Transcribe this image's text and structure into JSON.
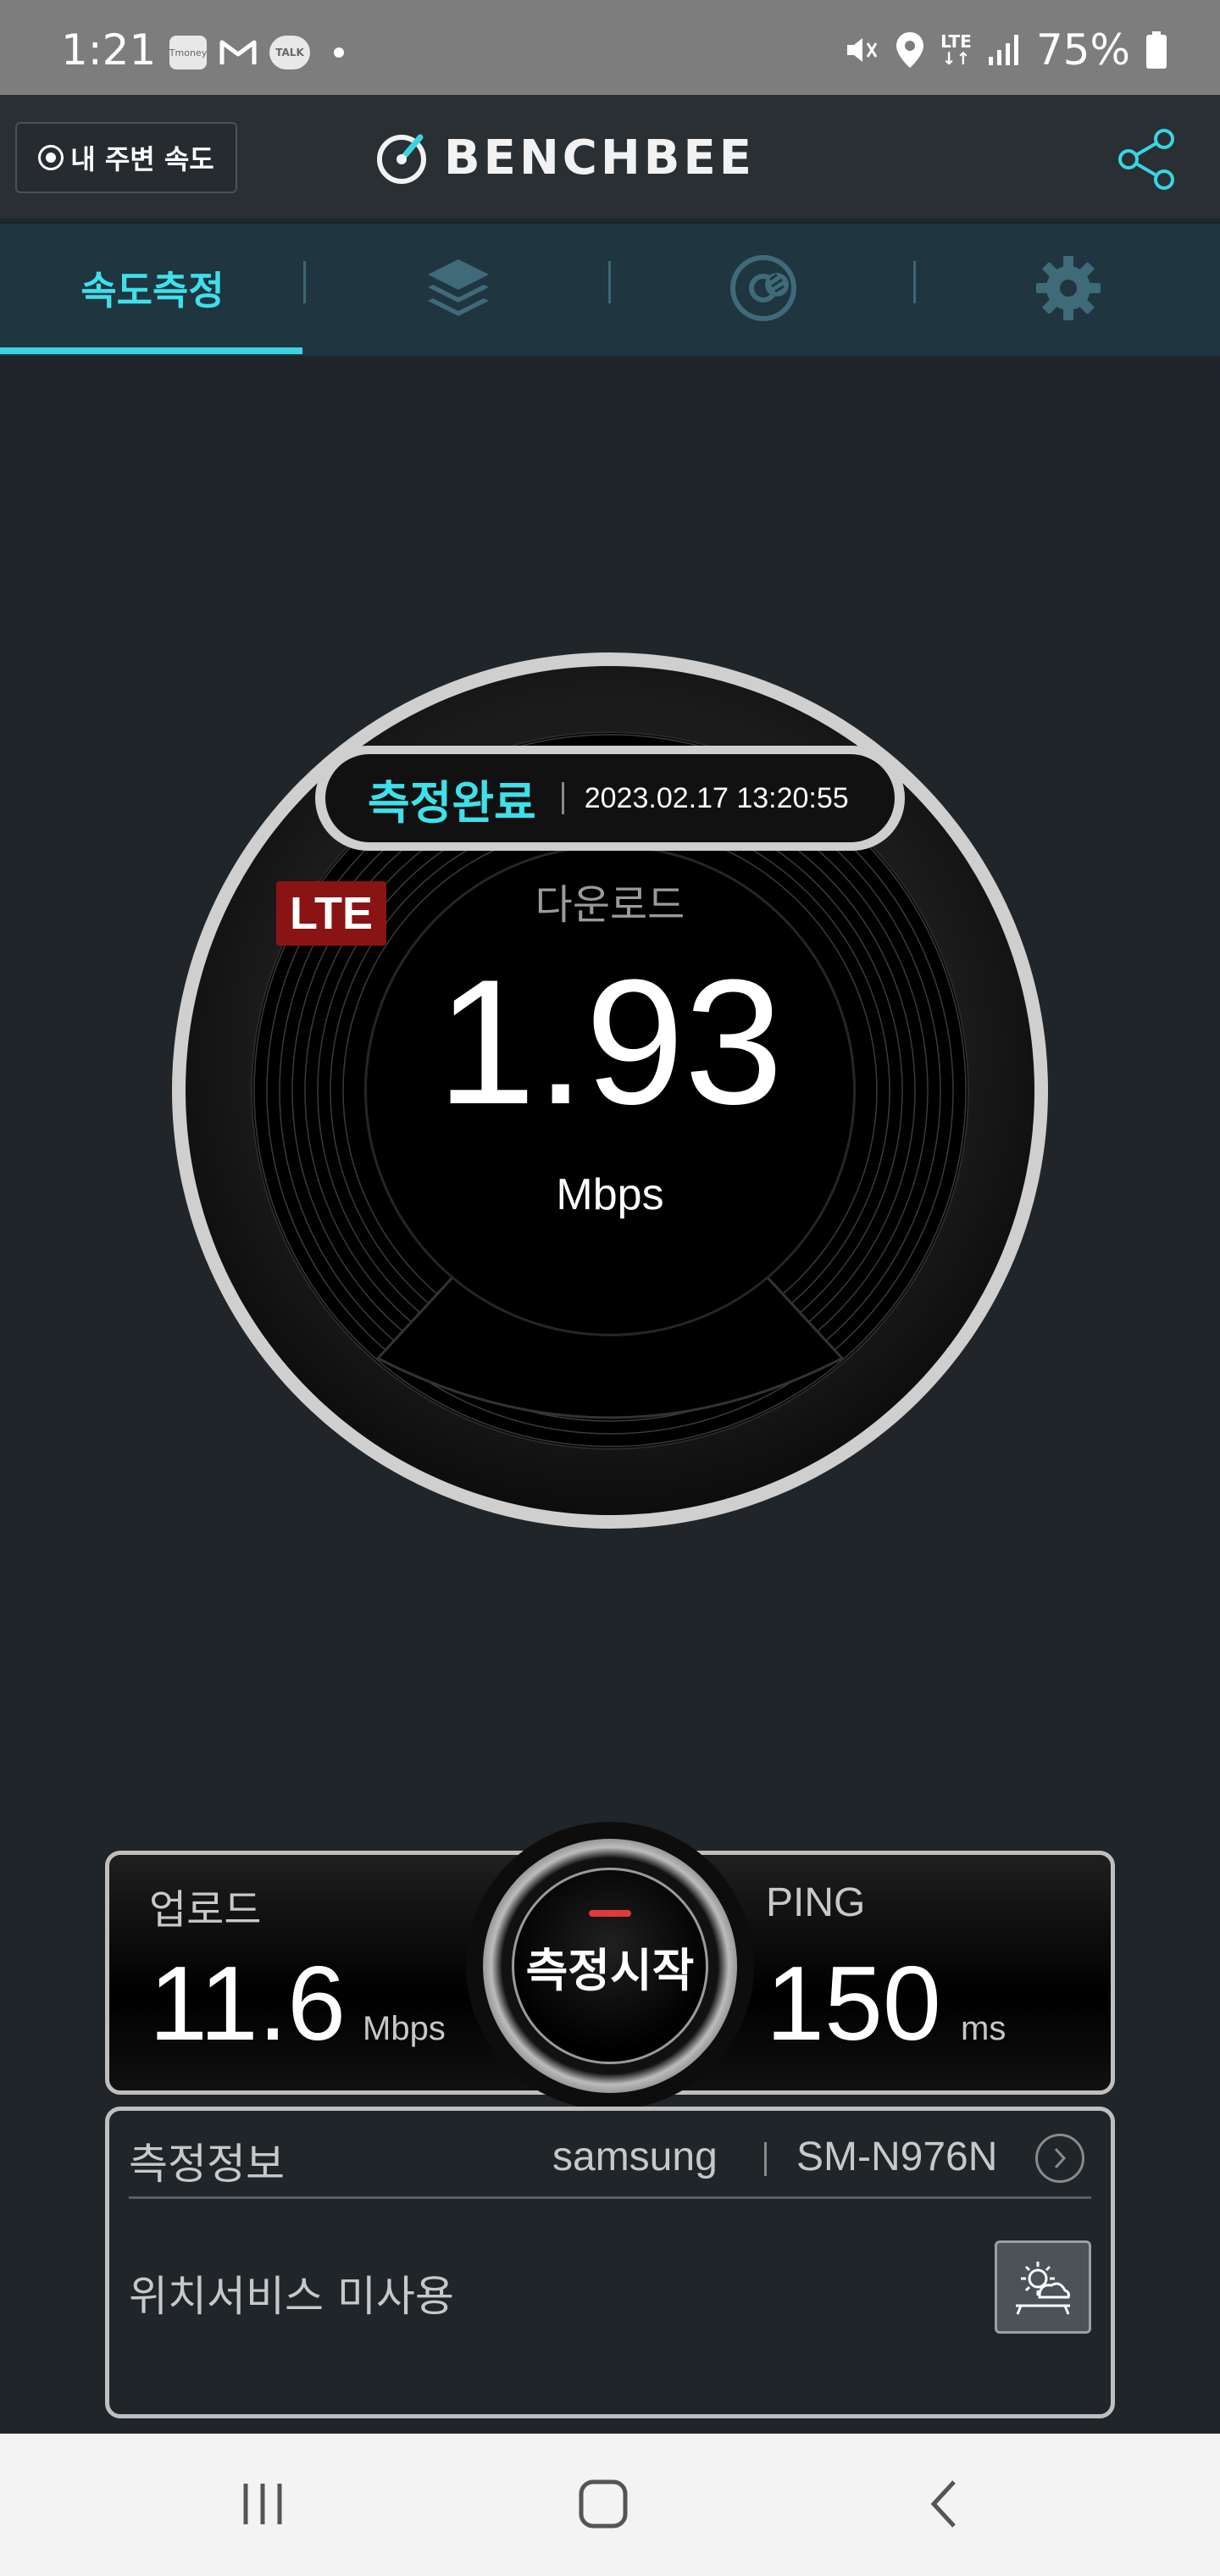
{
  "status_bar": {
    "time": "1:21",
    "app_icons": [
      "Tmoney",
      "Gmail",
      "TALK"
    ],
    "network": "LTE",
    "battery": "75%"
  },
  "header": {
    "near_speed_label": "내 주변 속도",
    "logo_text": "BENCHBEE",
    "share_icon": "share-icon"
  },
  "tabs": {
    "speed_test_label": "속도측정",
    "icons": [
      "layers-icon",
      "disc-chart-icon",
      "gear-icon"
    ],
    "active_color": "#3ad4e3"
  },
  "result": {
    "status_label": "측정완료",
    "timestamp": "2023.02.17 13:20:55",
    "network_badge": "LTE",
    "download_label": "다운로드",
    "download_value": "1.93",
    "download_unit": "Mbps"
  },
  "stats": {
    "upload_label": "업로드",
    "upload_value": "11.6",
    "upload_unit": "Mbps",
    "start_label": "측정시작",
    "ping_label": "PING",
    "ping_value": "150",
    "ping_unit": "ms"
  },
  "info": {
    "title": "측정정보",
    "manufacturer": "samsung",
    "model": "SM-N976N",
    "location_status": "위치서비스 미사용"
  },
  "nav": {
    "buttons": [
      "recent-apps-icon",
      "home-icon",
      "back-icon"
    ]
  }
}
